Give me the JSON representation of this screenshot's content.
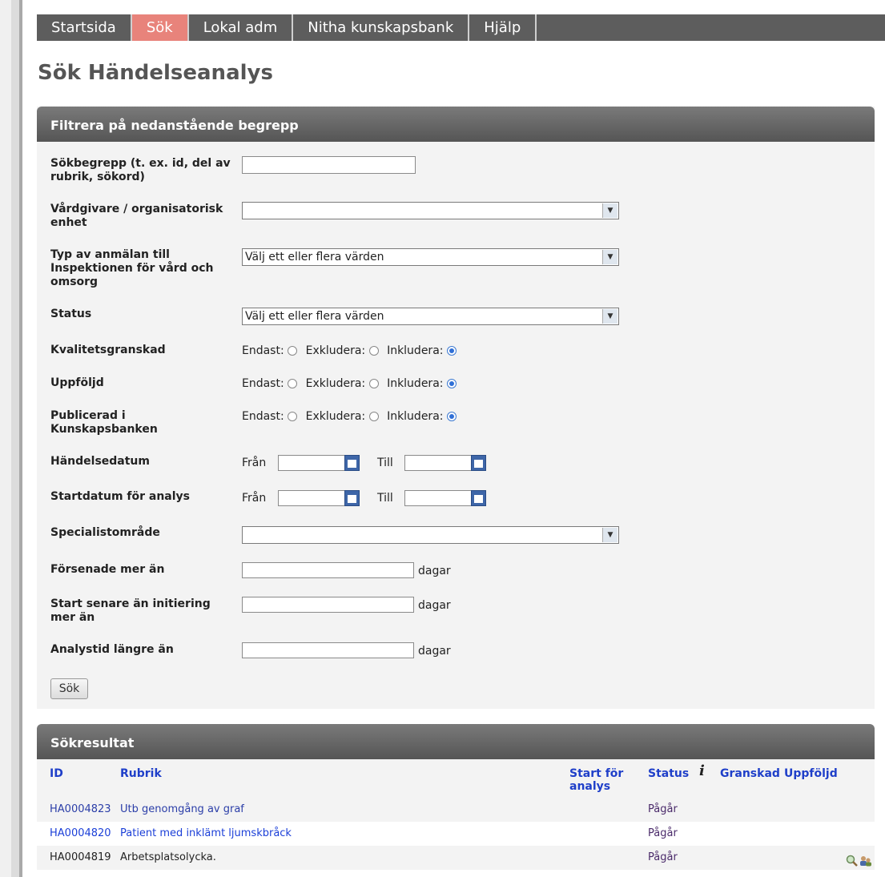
{
  "nav": [
    "Startsida",
    "Sök",
    "Lokal adm",
    "Nitha kunskapsbank",
    "Hjälp"
  ],
  "page_title": "Sök Händelseanalys",
  "filter": {
    "heading": "Filtrera på nedanstående begrepp",
    "search_label": "Sökbegrepp (t. ex. id, del av rubrik, sökord)",
    "caregiver_label": "Vårdgivare / organisatorisk enhet",
    "report_type_label": "Typ av anmälan till Inspektionen för vård och omsorg",
    "report_type_value": "Välj ett eller flera värden",
    "status_label": "Status",
    "status_value": "Välj ett eller flera värden",
    "quality_label": "Kvalitetsgranskad",
    "followup_label": "Uppföljd",
    "published_label": "Publicerad i Kunskapsbanken",
    "opt_only": "Endast:",
    "opt_exclude": "Exkludera:",
    "opt_include": "Inkludera:",
    "event_date_label": "Händelsedatum",
    "start_date_label": "Startdatum för analys",
    "from": "Från",
    "to": "Till",
    "specialty_label": "Specialistområde",
    "delayed_label": "Försenade mer än",
    "start_later_label": "Start senare än initiering mer än",
    "analysis_time_label": "Analystid längre än",
    "days": "dagar",
    "search_button": "Sök"
  },
  "results": {
    "heading": "Sökresultat",
    "columns": {
      "id": "ID",
      "rubrik": "Rubrik",
      "start": "Start för analys",
      "status": "Status",
      "info": "i",
      "granskad": "Granskad",
      "uppfoljd": "Uppföljd"
    },
    "rows": [
      {
        "id": "HA0004823",
        "rubrik": "Utb genomgång av graf",
        "status": "Pågår"
      },
      {
        "id": "HA0004820",
        "rubrik": "Patient med inklämt ljumskbråck",
        "status": "Pågår"
      },
      {
        "id": "HA0004819",
        "rubrik": "Arbetsplatsolycka.",
        "status": "Pågår"
      }
    ]
  }
}
